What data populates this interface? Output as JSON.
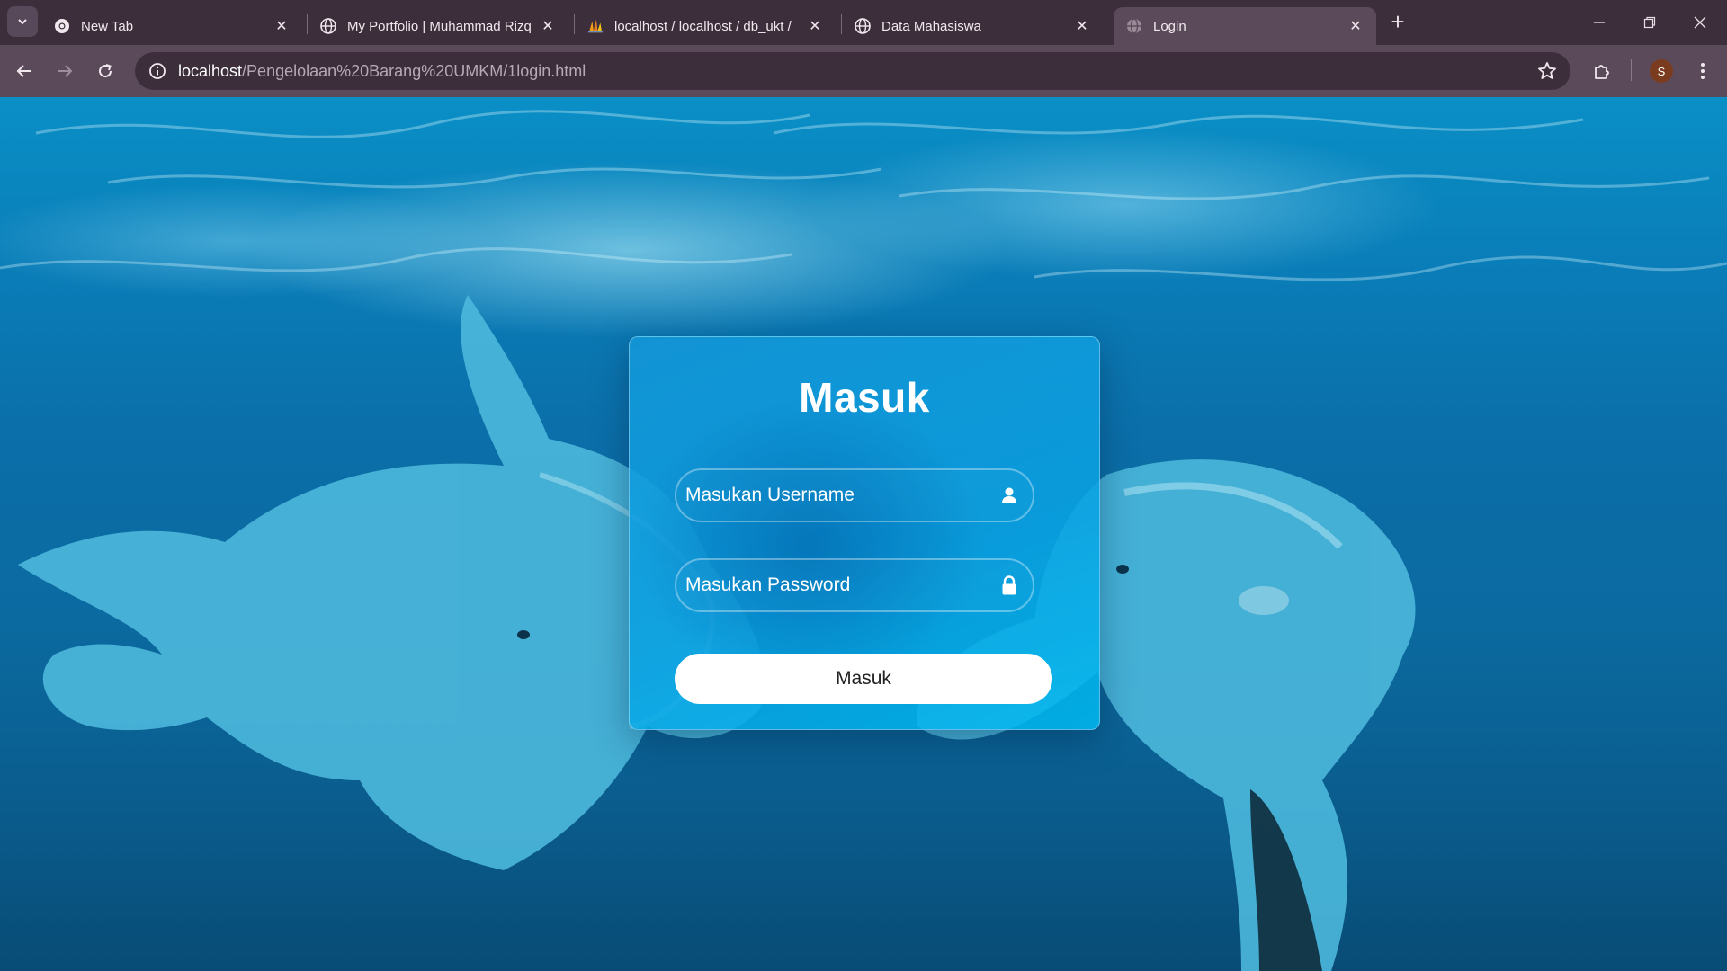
{
  "browser": {
    "tabs": [
      {
        "title": "New Tab",
        "favicon": "chrome-icon",
        "active": false
      },
      {
        "title": "My Portfolio | Muhammad Rizq",
        "favicon": "globe-icon",
        "active": false
      },
      {
        "title": "localhost / localhost / db_ukt / ",
        "favicon": "phpmyadmin-icon",
        "active": false
      },
      {
        "title": "Data Mahasiswa",
        "favicon": "globe-icon",
        "active": false
      },
      {
        "title": "Login",
        "favicon": "globe-icon",
        "active": true
      }
    ],
    "address": {
      "host": "localhost",
      "path": "/Pengelolaan%20Barang%20UMKM/1login.html"
    },
    "profile_initial": "S"
  },
  "login": {
    "title": "Masuk",
    "username_placeholder": "Masukan Username",
    "password_placeholder": "Masukan Password",
    "submit_label": "Masuk"
  },
  "colors": {
    "chrome_dark": "#3c2f3b",
    "chrome_mid": "#5b4b5a",
    "ocean": "#0a7bb6",
    "card": "#0ea0e0"
  }
}
